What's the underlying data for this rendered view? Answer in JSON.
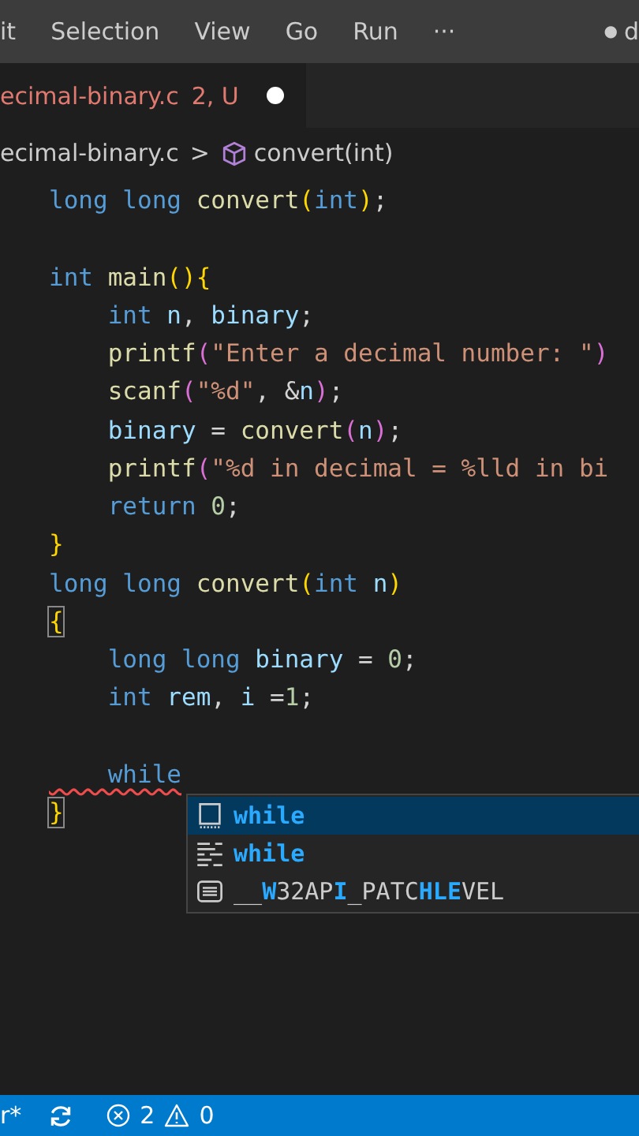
{
  "menu": [
    "it",
    "Selection",
    "View",
    "Go",
    "Run",
    "···"
  ],
  "title_fragment": {
    "dot": "●",
    "text": "d"
  },
  "tab": {
    "name": "ecimal-binary.c",
    "badge": "2, U",
    "dirty": true,
    "selected": true
  },
  "breadcrumbs": {
    "file": "ecimal-binary.c",
    "separator": ">",
    "symbol": "convert(int)"
  },
  "code": [
    {
      "tokens": [
        {
          "t": "long",
          "kind": "keyword"
        },
        {
          "t": " long",
          "kind": "keyword"
        },
        {
          "t": " convert",
          "kind": "function"
        },
        {
          "t": "(",
          "kind": "bracket"
        },
        {
          "t": "int",
          "kind": "keyword"
        },
        {
          "t": ")",
          "kind": "bracket"
        },
        {
          "t": ";",
          "kind": "plain"
        }
      ]
    },
    {
      "space_before": true,
      "tokens": [
        {
          "t": "int",
          "kind": "keyword"
        },
        {
          "t": " main",
          "kind": "function"
        },
        {
          "t": "(){",
          "kind": "bracket"
        }
      ]
    },
    {
      "tokens": [
        {
          "t": "    int",
          "kind": "keyword"
        },
        {
          "t": " n",
          "kind": "variable"
        },
        {
          "t": ", ",
          "kind": "plain"
        },
        {
          "t": "binary",
          "kind": "variable"
        },
        {
          "t": ";",
          "kind": "plain"
        }
      ]
    },
    {
      "tokens": [
        {
          "t": "    printf",
          "kind": "function"
        },
        {
          "t": "(",
          "kind": "bracket2"
        },
        {
          "t": "\"Enter a decimal number: \"",
          "kind": "string"
        },
        {
          "t": ")",
          "kind": "bracket2"
        }
      ]
    },
    {
      "tokens": [
        {
          "t": "    scanf",
          "kind": "function"
        },
        {
          "t": "(",
          "kind": "bracket2"
        },
        {
          "t": "\"%d\"",
          "kind": "string"
        },
        {
          "t": ", &",
          "kind": "plain"
        },
        {
          "t": "n",
          "kind": "variable"
        },
        {
          "t": ")",
          "kind": "bracket2"
        },
        {
          "t": ";",
          "kind": "plain"
        }
      ]
    },
    {
      "tokens": [
        {
          "t": "    binary",
          "kind": "variable"
        },
        {
          "t": " = ",
          "kind": "plain"
        },
        {
          "t": "convert",
          "kind": "function"
        },
        {
          "t": "(",
          "kind": "bracket2"
        },
        {
          "t": "n",
          "kind": "variable"
        },
        {
          "t": ")",
          "kind": "bracket2"
        },
        {
          "t": ";",
          "kind": "plain"
        }
      ]
    },
    {
      "tokens": [
        {
          "t": "    printf",
          "kind": "function"
        },
        {
          "t": "(",
          "kind": "bracket2"
        },
        {
          "t": "\"%d in decimal = %lld in bi",
          "kind": "string"
        }
      ]
    },
    {
      "tokens": [
        {
          "t": "    return",
          "kind": "keyword"
        },
        {
          "t": " 0",
          "kind": "number"
        },
        {
          "t": ";",
          "kind": "plain"
        }
      ]
    },
    {
      "tokens": [
        {
          "t": "}",
          "kind": "bracket"
        }
      ]
    },
    {
      "tokens": [
        {
          "t": "long",
          "kind": "keyword"
        },
        {
          "t": " long",
          "kind": "keyword"
        },
        {
          "t": " convert",
          "kind": "function"
        },
        {
          "t": "(",
          "kind": "bracket"
        },
        {
          "t": "int",
          "kind": "keyword"
        },
        {
          "t": " n",
          "kind": "variable"
        },
        {
          "t": ")",
          "kind": "bracket"
        }
      ]
    },
    {
      "tokens": [
        {
          "t": "{",
          "kind": "bracket",
          "match": true
        }
      ]
    },
    {
      "tokens": [
        {
          "t": "    long",
          "kind": "keyword"
        },
        {
          "t": " long",
          "kind": "keyword"
        },
        {
          "t": " binary",
          "kind": "variable"
        },
        {
          "t": " = ",
          "kind": "plain"
        },
        {
          "t": "0",
          "kind": "number"
        },
        {
          "t": ";",
          "kind": "plain"
        }
      ]
    },
    {
      "tokens": [
        {
          "t": "    int",
          "kind": "keyword"
        },
        {
          "t": " rem",
          "kind": "variable"
        },
        {
          "t": ", ",
          "kind": "plain"
        },
        {
          "t": "i",
          "kind": "variable"
        },
        {
          "t": " =",
          "kind": "plain"
        },
        {
          "t": "1",
          "kind": "number"
        },
        {
          "t": ";",
          "kind": "plain"
        }
      ]
    },
    {
      "space_before": true,
      "tokens": [
        {
          "t": "    while",
          "kind": "keyword",
          "squiggle": true
        }
      ]
    },
    {
      "tokens": [
        {
          "t": "}",
          "kind": "bracket",
          "match": true
        }
      ]
    }
  ],
  "suggestions": [
    {
      "kind": "keyword",
      "selected": true,
      "label": [
        {
          "t": "while",
          "m": true
        }
      ]
    },
    {
      "kind": "snippet",
      "selected": false,
      "label": [
        {
          "t": "while",
          "m": true
        }
      ]
    },
    {
      "kind": "text",
      "selected": false,
      "label": [
        {
          "t": "__",
          "m": false
        },
        {
          "t": "W",
          "m": true
        },
        {
          "t": "32AP",
          "m": false
        },
        {
          "t": "I",
          "m": true
        },
        {
          "t": "_PATC",
          "m": false
        },
        {
          "t": "HLE",
          "m": true
        },
        {
          "t": "VEL",
          "m": false
        }
      ]
    }
  ],
  "status_bar": {
    "branch": "r*",
    "errors": "2",
    "warnings": "0"
  }
}
